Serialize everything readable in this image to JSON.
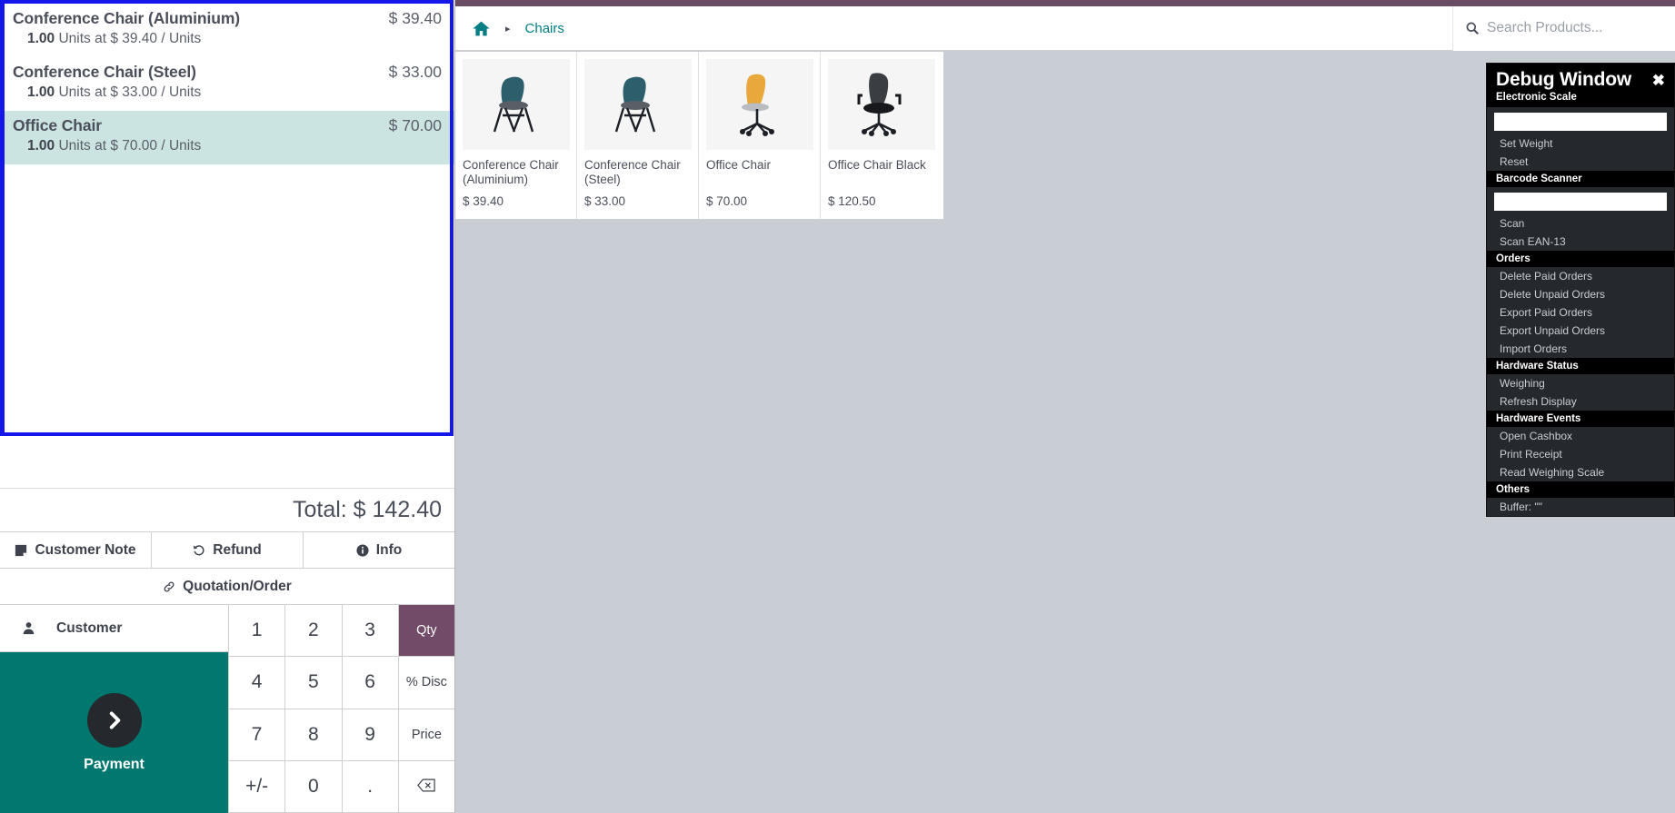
{
  "order": {
    "lines": [
      {
        "name": "Conference Chair (Aluminium)",
        "qty": "1.00",
        "detail": " Units at $ 39.40 / Units",
        "price": "$ 39.40",
        "selected": false
      },
      {
        "name": "Conference Chair (Steel)",
        "qty": "1.00",
        "detail": " Units at $ 33.00 / Units",
        "price": "$ 33.00",
        "selected": false
      },
      {
        "name": "Office Chair",
        "qty": "1.00",
        "detail": " Units at $ 70.00 / Units",
        "price": "$ 70.00",
        "selected": true
      }
    ],
    "total_label": "Total: $ 142.40"
  },
  "actions": {
    "customer_note": "Customer Note",
    "refund": "Refund",
    "info": "Info",
    "quotation_order": "Quotation/Order"
  },
  "customer": {
    "label": "Customer"
  },
  "payment": {
    "label": "Payment"
  },
  "numpad": {
    "keys": [
      {
        "label": "1",
        "style": ""
      },
      {
        "label": "2",
        "style": ""
      },
      {
        "label": "3",
        "style": ""
      },
      {
        "label": "Qty",
        "style": "active"
      },
      {
        "label": "4",
        "style": ""
      },
      {
        "label": "5",
        "style": ""
      },
      {
        "label": "6",
        "style": ""
      },
      {
        "label": "% Disc",
        "style": "small"
      },
      {
        "label": "7",
        "style": ""
      },
      {
        "label": "8",
        "style": ""
      },
      {
        "label": "9",
        "style": ""
      },
      {
        "label": "Price",
        "style": "small"
      },
      {
        "label": "+/-",
        "style": ""
      },
      {
        "label": "0",
        "style": ""
      },
      {
        "label": ".",
        "style": ""
      },
      {
        "label": "",
        "style": "backspace"
      }
    ]
  },
  "topbar": {
    "home_icon": "home-icon",
    "separator": "▸",
    "breadcrumb": "Chairs"
  },
  "search": {
    "placeholder": "Search Products...",
    "value": "",
    "icon": "search-icon",
    "clear": "✖"
  },
  "products": [
    {
      "name": "Conference Chair (Aluminium)",
      "price": "$ 39.40",
      "image": "chair-teal"
    },
    {
      "name": "Conference Chair (Steel)",
      "price": "$ 33.00",
      "image": "chair-teal"
    },
    {
      "name": "Office Chair",
      "price": "$ 70.00",
      "image": "chair-orange"
    },
    {
      "name": "Office Chair Black",
      "price": "$ 120.50",
      "image": "chair-black"
    }
  ],
  "debug": {
    "title": "Debug Window",
    "close": "✖",
    "sections": [
      {
        "head": "Electronic Scale",
        "head_in_title": true,
        "input": "",
        "items": [
          "Set Weight",
          "Reset"
        ]
      },
      {
        "head": "Barcode Scanner",
        "input": "",
        "items": [
          "Scan",
          "Scan EAN-13"
        ]
      },
      {
        "head": "Orders",
        "items": [
          "Delete Paid Orders",
          "Delete Unpaid Orders",
          "Export Paid Orders",
          "Export Unpaid Orders",
          "Import Orders"
        ]
      },
      {
        "head": "Hardware Status",
        "items": [
          "Weighing",
          "Refresh Display"
        ]
      },
      {
        "head": "Hardware Events",
        "items": [
          "Open Cashbox",
          "Print Receipt",
          "Read Weighing Scale"
        ]
      },
      {
        "head": "Others",
        "items": [
          "Buffer: \"\""
        ]
      }
    ]
  },
  "colors": {
    "accent_purple": "#714b67",
    "top_strip": "#6b4d63",
    "payment_teal": "#00786f",
    "link_teal": "#017e84",
    "selected_row": "#cbe3e1",
    "focus_border": "#1517e8",
    "background": "#c9cdd4",
    "debug_bg": "#25282c"
  }
}
